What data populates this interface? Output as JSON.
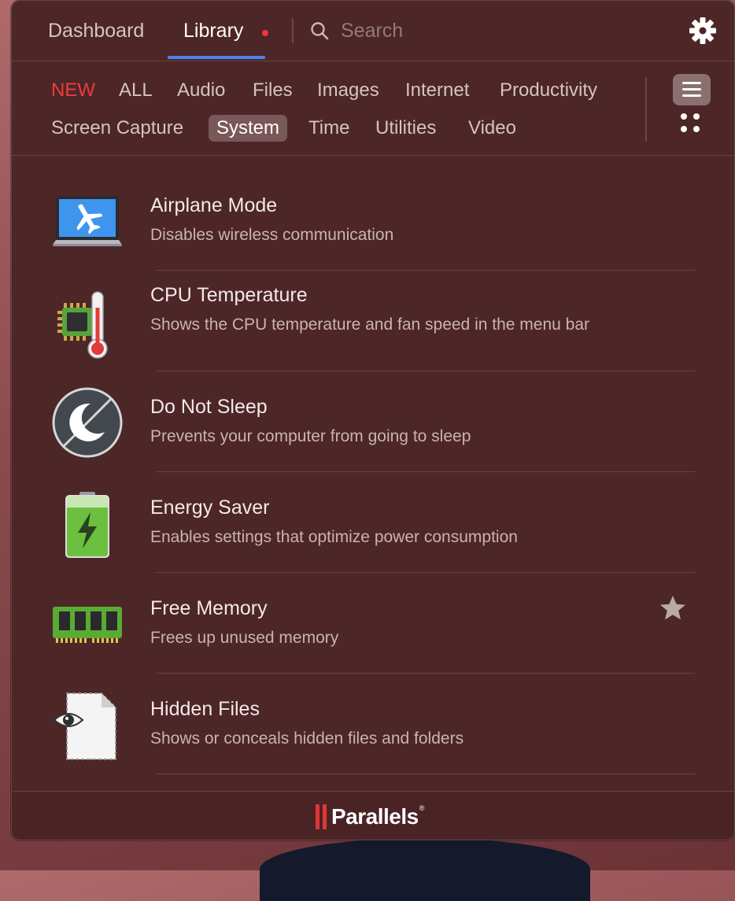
{
  "nav": {
    "tabs": [
      {
        "label": "Dashboard"
      },
      {
        "label": "Library"
      }
    ],
    "search_placeholder": "Search"
  },
  "categories": [
    "NEW",
    "ALL",
    "Audio",
    "Files",
    "Images",
    "Internet",
    "Productivity",
    "Screen Capture",
    "System",
    "Time",
    "Utilities",
    "Video"
  ],
  "selected_category": "System",
  "items": [
    {
      "title": "Airplane Mode",
      "desc": "Disables wireless communication",
      "icon": "airplane-mode-icon"
    },
    {
      "title": "CPU Temperature",
      "desc": "Shows the CPU temperature and fan speed in the menu bar",
      "icon": "cpu-temperature-icon"
    },
    {
      "title": "Do Not Sleep",
      "desc": "Prevents your computer from going to sleep",
      "icon": "moon-icon"
    },
    {
      "title": "Energy Saver",
      "desc": "Enables settings that optimize power consumption",
      "icon": "battery-icon"
    },
    {
      "title": "Free Memory",
      "desc": "Frees up unused memory",
      "icon": "memory-chip-icon",
      "favorite": true
    },
    {
      "title": "Hidden Files",
      "desc": "Shows or conceals hidden files and folders",
      "icon": "hidden-files-icon"
    }
  ],
  "footer": {
    "brand": "Parallels"
  },
  "colors": {
    "accent": "#4b84f0",
    "new": "#ef3b3b",
    "badge": "#ec3a3a",
    "panel": "#4d2627"
  }
}
